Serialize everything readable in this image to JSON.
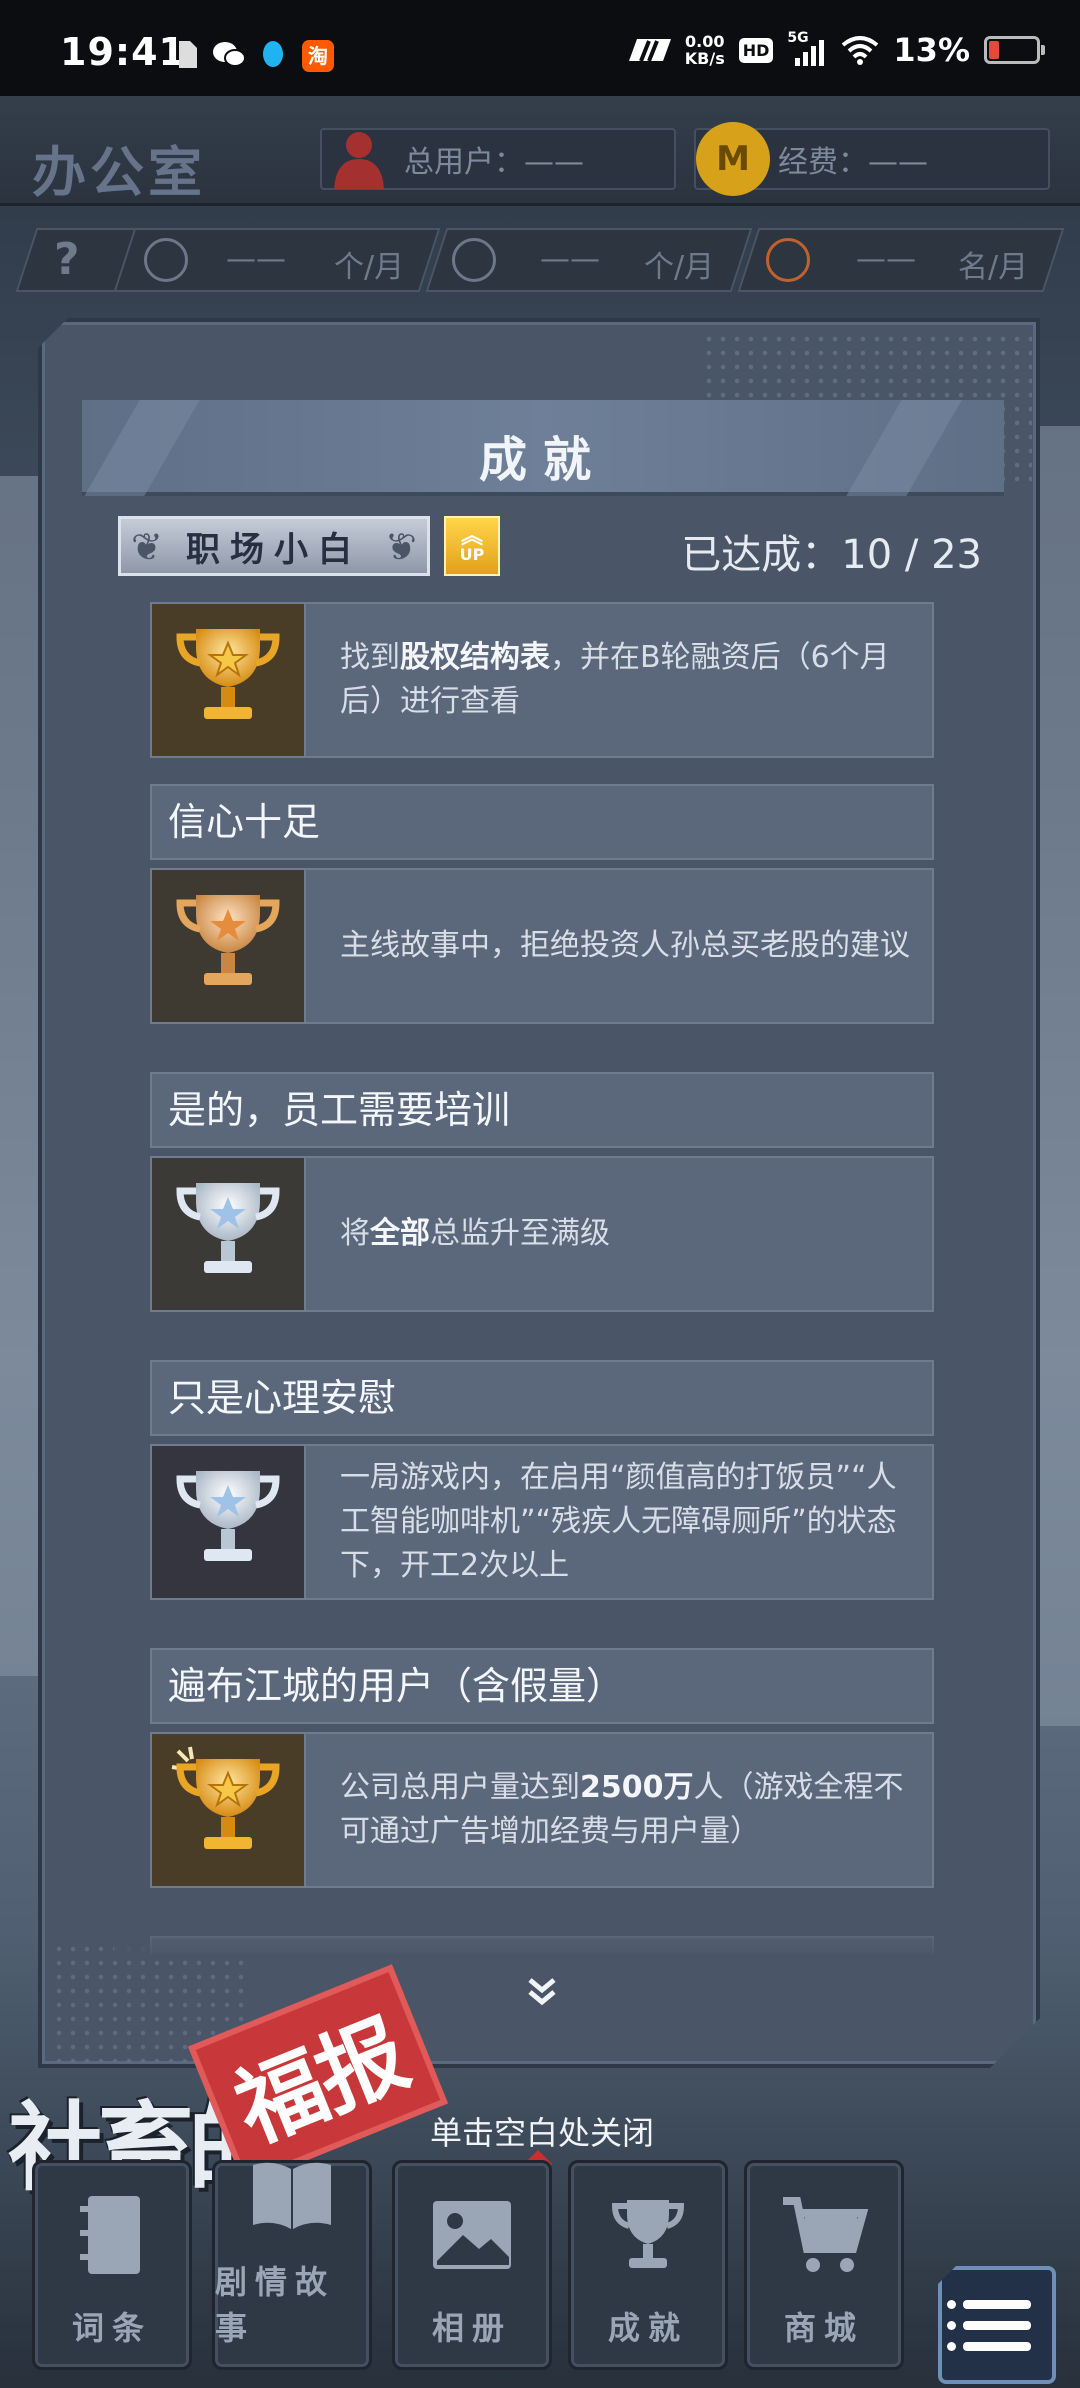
{
  "status_bar": {
    "time": "19:41",
    "network_speed_value": "0.00",
    "network_speed_unit": "KB/s",
    "hd_label": "HD",
    "signal_label": "5G",
    "battery_percent": "13%",
    "notification_app_label": "淘"
  },
  "office": {
    "title": "办公室",
    "users_label": "总用户：——",
    "funds_label": "经费：——",
    "funds_icon_letter": "M",
    "rows": [
      {
        "value": "——",
        "unit": "个/月"
      },
      {
        "value": "——",
        "unit": "个/月"
      },
      {
        "value": "——",
        "unit": "名/月"
      }
    ],
    "help_icon": "?"
  },
  "modal": {
    "title": "成就",
    "rank_label": "职场小白",
    "up_label": "UP",
    "progress_prefix": "已达成：",
    "progress_value": "10 / 23",
    "achievements": [
      {
        "title": "",
        "desc_parts": [
          "找到",
          "股权结构表",
          "，并在B轮融资后（6个月后）进行查看"
        ],
        "trophy": "gold"
      },
      {
        "title": "信心十足",
        "desc_parts": [
          "主线故事中，拒绝投资人孙总买老股的建议"
        ],
        "trophy": "bronze"
      },
      {
        "title": "是的，员工需要培训",
        "desc_parts": [
          "将",
          "全部",
          "总监升至满级"
        ],
        "trophy": "silver"
      },
      {
        "title": "只是心理安慰",
        "desc_parts": [
          "一局游戏内，在启用“颜值高的打饭员”“人工智能咖啡机”“残疾人无障碍厕所”的状态下，开工2次以上"
        ],
        "trophy": "silver"
      },
      {
        "title": "遍布江城的用户（含假量）",
        "desc_parts": [
          "公司总用户量达到",
          "2500万",
          "人（游戏全程不可通过广告增加经费与用户量）"
        ],
        "trophy": "gold"
      }
    ],
    "scroll_more_icon": "»",
    "close_hint": "单击空白处关闭"
  },
  "logo": {
    "main_text": "社畜的",
    "stamp_text": "福报"
  },
  "bottom_nav": [
    {
      "label": "词条",
      "icon": "notebook-icon"
    },
    {
      "label": "剧情故事",
      "icon": "book-icon"
    },
    {
      "label": "相册",
      "icon": "photo-icon"
    },
    {
      "label": "成就",
      "icon": "trophy-icon"
    },
    {
      "label": "商城",
      "icon": "cart-icon"
    }
  ],
  "colors": {
    "modal_bg": "#4a5567",
    "card_bg": "#5b677a",
    "gold": "#f2b531",
    "silver": "#dfe8f2",
    "bronze": "#e4a65c",
    "stamp_red": "#c8383a"
  }
}
